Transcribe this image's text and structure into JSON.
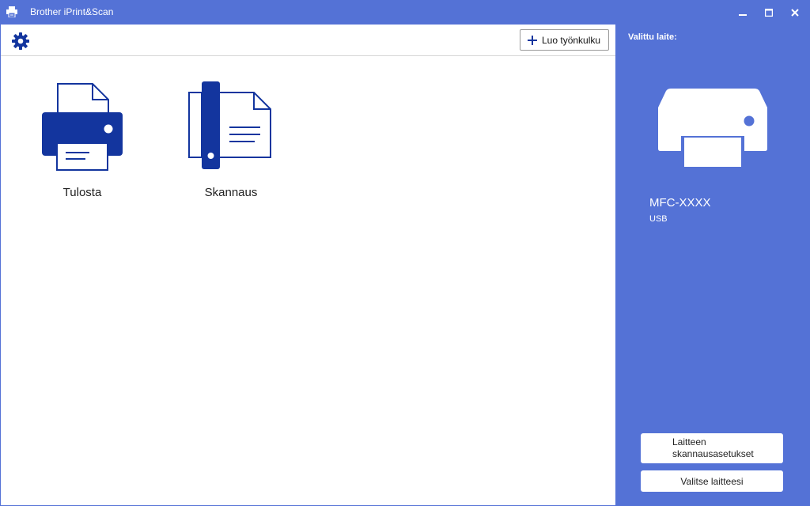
{
  "window": {
    "title": "Brother iPrint&Scan",
    "app_icon": "printer-app-icon",
    "controls": [
      "minimize-icon",
      "maximize-icon",
      "close-icon"
    ]
  },
  "toolbar": {
    "settings_icon": "gear-icon",
    "create_workflow_label": "Luo työnkulku"
  },
  "tiles": [
    {
      "id": "print",
      "label": "Tulosta",
      "icon": "printer-icon"
    },
    {
      "id": "scan",
      "label": "Skannaus",
      "icon": "scanner-icon"
    }
  ],
  "sidebar": {
    "heading": "Valittu laite:",
    "device_icon": "device-printer-icon",
    "device_model": "MFC-XXXX",
    "connection": "USB",
    "scan_settings_line1": "Laitteen",
    "scan_settings_line2": "skannausasetukset",
    "select_device_label": "Valitse laitteesi"
  },
  "colors": {
    "accent": "#5472d6",
    "icon_blue": "#13359e",
    "background": "#ffffff"
  }
}
